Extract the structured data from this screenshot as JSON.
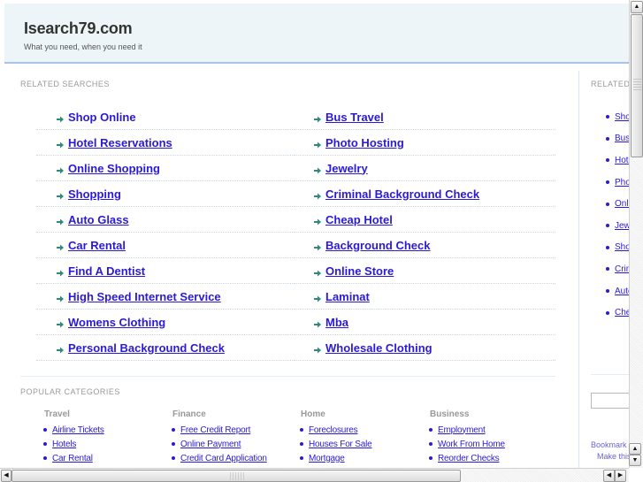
{
  "header": {
    "title": "Isearch79.com",
    "tagline": "What you need, when you need it"
  },
  "related_searches": {
    "heading": "RELATED SEARCHES",
    "left": [
      {
        "label": "Shop Online"
      },
      {
        "label": "Hotel Reservations"
      },
      {
        "label": "Online Shopping"
      },
      {
        "label": "Shopping"
      },
      {
        "label": "Auto Glass"
      },
      {
        "label": "Car Rental"
      },
      {
        "label": "Find A Dentist"
      },
      {
        "label": "High Speed Internet Service"
      },
      {
        "label": "Womens Clothing"
      },
      {
        "label": "Personal Background Check"
      }
    ],
    "right": [
      {
        "label": "Bus Travel"
      },
      {
        "label": "Photo Hosting"
      },
      {
        "label": "Jewelry"
      },
      {
        "label": "Criminal Background Check"
      },
      {
        "label": "Cheap Hotel"
      },
      {
        "label": "Background Check"
      },
      {
        "label": "Online Store"
      },
      {
        "label": "Laminat"
      },
      {
        "label": "Mba"
      },
      {
        "label": "Wholesale Clothing"
      }
    ]
  },
  "popular_categories": {
    "heading": "POPULAR CATEGORIES",
    "columns": [
      {
        "title": "Travel",
        "items": [
          "Airline Tickets",
          "Hotels",
          "Car Rental"
        ]
      },
      {
        "title": "Finance",
        "items": [
          "Free Credit Report",
          "Online Payment",
          "Credit Card Application"
        ]
      },
      {
        "title": "Home",
        "items": [
          "Foreclosures",
          "Houses For Sale",
          "Mortgage"
        ]
      },
      {
        "title": "Business",
        "items": [
          "Employment",
          "Work From Home",
          "Reorder Checks"
        ]
      }
    ]
  },
  "sidebar": {
    "heading": "RELATED",
    "items": [
      "Shop Online",
      "Bus Travel",
      "Hotel Reservations",
      "Photo Hosting",
      "Online Shopping",
      "Jewelry",
      "Shopping",
      "Criminal Background Check",
      "Auto Glass",
      "Cheap Hotel"
    ],
    "search_value": "",
    "bookmark_text": "Bookmark",
    "make_text": "Make this"
  },
  "colors": {
    "link": "#2a1ad6",
    "arrow": "#2e8b7a",
    "header_bg": "#eef5f8",
    "header_border": "#a9c3e8"
  },
  "icons": {
    "scroll_up": "▲",
    "scroll_down": "▼",
    "scroll_left": "◀",
    "scroll_right": "▶"
  }
}
